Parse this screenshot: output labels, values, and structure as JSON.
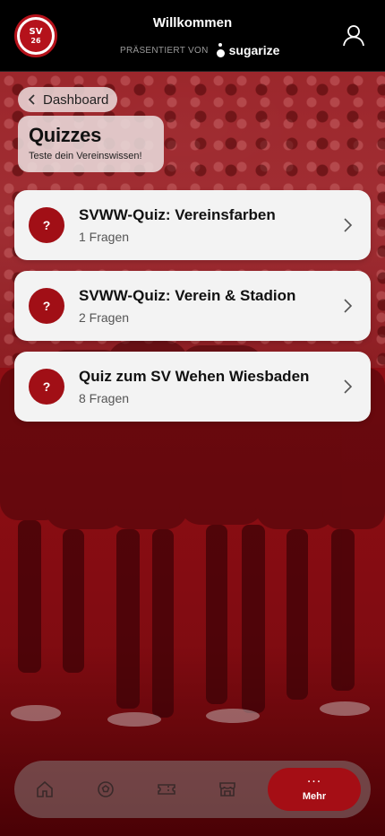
{
  "header": {
    "title": "Willkommen",
    "presented_by": "PRÄSENTIERT VON",
    "sponsor": "sugarize",
    "logo_text": "SV",
    "logo_number": "26",
    "user_icon": "user-icon"
  },
  "nav": {
    "back_label": "Dashboard",
    "back_icon": "chevron-left-icon"
  },
  "page": {
    "title": "Quizzes",
    "subtitle": "Teste dein Vereinswissen!"
  },
  "quizzes": [
    {
      "badge": "?",
      "title": "SVWW-Quiz: Vereinsfarben",
      "count": "1 Fragen"
    },
    {
      "badge": "?",
      "title": "SVWW-Quiz: Verein & Stadion",
      "count": "2 Fragen"
    },
    {
      "badge": "?",
      "title": "Quiz zum SV Wehen Wiesbaden",
      "count": "8 Fragen"
    }
  ],
  "tabbar": {
    "items": [
      {
        "icon": "home-icon"
      },
      {
        "icon": "football-icon"
      },
      {
        "icon": "ticket-icon"
      },
      {
        "icon": "shop-icon"
      }
    ],
    "active": {
      "dots": "···",
      "label": "Mehr",
      "icon": "more-icon"
    }
  },
  "colors": {
    "accent": "#a10f16",
    "card": "#f3f3f3",
    "header": "#000000"
  }
}
